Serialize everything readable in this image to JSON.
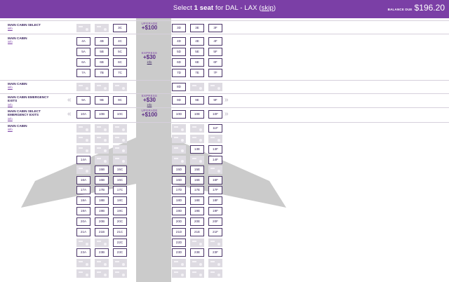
{
  "header": {
    "prefix": "Select",
    "count": "1 seat",
    "route_prefix": "for DAL - LAX",
    "skip": "skip",
    "balance_label": "BALANCE DUE",
    "balance_amount": "$196.20"
  },
  "colors": {
    "brand": "#7b3fa6",
    "seat_border": "#4a3468",
    "taken": "#dedbe2",
    "plane": "#c8c8c8"
  },
  "info_label": "info",
  "cabins": [
    {
      "name": "MAIN CABIN SELECT"
    },
    {
      "name": "MAIN CABIN"
    },
    {
      "name": "MAIN CABIN"
    },
    {
      "name": "MAIN CABIN EMERGENCY EXITS"
    },
    {
      "name": "MAIN CABIN SELECT EMERGENCY EXITS"
    },
    {
      "name": "MAIN CABIN"
    }
  ],
  "upsells": [
    {
      "kind": "UPGRADE",
      "price": "+$100",
      "info": ""
    },
    {
      "kind": "EXPRESS",
      "price": "+$30",
      "info": "info"
    },
    {
      "kind": "EXPRESS",
      "price": "+$30",
      "info": "info"
    },
    {
      "kind": "UPGRADE",
      "price": "+$100",
      "info": ""
    }
  ],
  "exit_markers": [
    "«",
    "»"
  ],
  "rows": [
    {
      "label": "3",
      "seats": [
        [
          "3A",
          "taken"
        ],
        [
          "3B",
          "taken"
        ],
        [
          "3C",
          "open"
        ],
        [
          "3D",
          "open"
        ],
        [
          "3E",
          "open"
        ],
        [
          "3F",
          "open"
        ]
      ]
    },
    {
      "label": "4",
      "seats": [
        [
          "4A",
          "open"
        ],
        [
          "4B",
          "open"
        ],
        [
          "4C",
          "open"
        ],
        [
          "4D",
          "open"
        ],
        [
          "4E",
          "open"
        ],
        [
          "4F",
          "open"
        ]
      ]
    },
    {
      "label": "5",
      "seats": [
        [
          "5A",
          "open"
        ],
        [
          "5B",
          "open"
        ],
        [
          "5C",
          "open"
        ],
        [
          "5D",
          "open"
        ],
        [
          "5E",
          "open"
        ],
        [
          "5F",
          "open"
        ]
      ]
    },
    {
      "label": "6",
      "seats": [
        [
          "6A",
          "open"
        ],
        [
          "6B",
          "open"
        ],
        [
          "6C",
          "open"
        ],
        [
          "6D",
          "open"
        ],
        [
          "6E",
          "open"
        ],
        [
          "6F",
          "open"
        ]
      ]
    },
    {
      "label": "7",
      "seats": [
        [
          "7A",
          "open"
        ],
        [
          "7B",
          "open"
        ],
        [
          "7C",
          "open"
        ],
        [
          "7D",
          "open"
        ],
        [
          "7E",
          "open"
        ],
        [
          "7F",
          "open"
        ]
      ]
    },
    {
      "label": "8",
      "seats": [
        [
          "8A",
          "taken"
        ],
        [
          "8B",
          "taken"
        ],
        [
          "8C",
          "taken"
        ],
        [
          "8D",
          "open"
        ],
        [
          "8E",
          "taken"
        ],
        [
          "8F",
          "taken"
        ]
      ]
    },
    {
      "label": "9",
      "seats": [
        [
          "9A",
          "open"
        ],
        [
          "9B",
          "open"
        ],
        [
          "9C",
          "open"
        ],
        [
          "9D",
          "open"
        ],
        [
          "9E",
          "open"
        ],
        [
          "9F",
          "open"
        ]
      ]
    },
    {
      "label": "10",
      "seats": [
        [
          "10A",
          "open"
        ],
        [
          "10B",
          "open"
        ],
        [
          "10C",
          "open"
        ],
        [
          "10D",
          "open"
        ],
        [
          "10E",
          "open"
        ],
        [
          "10F",
          "open"
        ]
      ]
    },
    {
      "label": "11",
      "seats": [
        [
          "11A",
          "taken"
        ],
        [
          "11B",
          "taken"
        ],
        [
          "11C",
          "taken"
        ],
        [
          "11D",
          "taken"
        ],
        [
          "11E",
          "taken"
        ],
        [
          "11F",
          "open"
        ]
      ]
    },
    {
      "label": "12",
      "seats": [
        [
          "12A",
          "taken"
        ],
        [
          "12B",
          "taken"
        ],
        [
          "12C",
          "taken"
        ],
        [
          "12D",
          "taken"
        ],
        [
          "12E",
          "taken"
        ],
        [
          "12F",
          "taken"
        ]
      ]
    },
    {
      "label": "13",
      "seats": [
        [
          "13A",
          "taken"
        ],
        [
          "13B",
          "taken"
        ],
        [
          "13C",
          "taken"
        ],
        [
          "13D",
          "taken"
        ],
        [
          "13E",
          "open"
        ],
        [
          "13F",
          "open"
        ]
      ]
    },
    {
      "label": "14",
      "seats": [
        [
          "14A",
          "open"
        ],
        [
          "14B",
          "taken"
        ],
        [
          "14C",
          "taken"
        ],
        [
          "14D",
          "taken"
        ],
        [
          "14E",
          "taken"
        ],
        [
          "14F",
          "open"
        ]
      ]
    },
    {
      "label": "15",
      "seats": [
        [
          "15A",
          "taken"
        ],
        [
          "15B",
          "open"
        ],
        [
          "15C",
          "open"
        ],
        [
          "15D",
          "open"
        ],
        [
          "15E",
          "open"
        ],
        [
          "15F",
          "taken"
        ]
      ]
    },
    {
      "label": "16",
      "seats": [
        [
          "16A",
          "open"
        ],
        [
          "16B",
          "open"
        ],
        [
          "16C",
          "open"
        ],
        [
          "16D",
          "open"
        ],
        [
          "16E",
          "open"
        ],
        [
          "16F",
          "open"
        ]
      ]
    },
    {
      "label": "17",
      "seats": [
        [
          "17A",
          "open"
        ],
        [
          "17B",
          "open"
        ],
        [
          "17C",
          "open"
        ],
        [
          "17D",
          "open"
        ],
        [
          "17E",
          "open"
        ],
        [
          "17F",
          "open"
        ]
      ]
    },
    {
      "label": "18",
      "seats": [
        [
          "18A",
          "open"
        ],
        [
          "18B",
          "open"
        ],
        [
          "18C",
          "open"
        ],
        [
          "18D",
          "open"
        ],
        [
          "18E",
          "open"
        ],
        [
          "18F",
          "open"
        ]
      ]
    },
    {
      "label": "19",
      "seats": [
        [
          "19A",
          "open"
        ],
        [
          "19B",
          "open"
        ],
        [
          "19C",
          "open"
        ],
        [
          "19D",
          "open"
        ],
        [
          "19E",
          "open"
        ],
        [
          "19F",
          "open"
        ]
      ]
    },
    {
      "label": "20",
      "seats": [
        [
          "20A",
          "open"
        ],
        [
          "20B",
          "open"
        ],
        [
          "20C",
          "open"
        ],
        [
          "20D",
          "open"
        ],
        [
          "20E",
          "open"
        ],
        [
          "20F",
          "open"
        ]
      ]
    },
    {
      "label": "21",
      "seats": [
        [
          "21A",
          "open"
        ],
        [
          "21B",
          "open"
        ],
        [
          "21C",
          "open"
        ],
        [
          "21D",
          "open"
        ],
        [
          "21E",
          "open"
        ],
        [
          "21F",
          "open"
        ]
      ]
    },
    {
      "label": "22",
      "seats": [
        [
          "22A",
          "taken"
        ],
        [
          "22B",
          "taken"
        ],
        [
          "22C",
          "open"
        ],
        [
          "22D",
          "open"
        ],
        [
          "22E",
          "taken"
        ],
        [
          "22F",
          "taken"
        ]
      ]
    },
    {
      "label": "23",
      "seats": [
        [
          "23A",
          "open"
        ],
        [
          "23B",
          "open"
        ],
        [
          "23C",
          "open"
        ],
        [
          "23D",
          "open"
        ],
        [
          "23E",
          "open"
        ],
        [
          "23F",
          "open"
        ]
      ]
    },
    {
      "label": "24",
      "seats": [
        [
          "24A",
          "taken"
        ],
        [
          "24B",
          "taken"
        ],
        [
          "24C",
          "taken"
        ],
        [
          "24D",
          "taken"
        ],
        [
          "24E",
          "taken"
        ],
        [
          "24F",
          "taken"
        ]
      ]
    },
    {
      "label": "25",
      "seats": [
        [
          "25A",
          "taken"
        ],
        [
          "25B",
          "taken"
        ],
        [
          "25C",
          "taken"
        ],
        [
          "25D",
          "taken"
        ],
        [
          "25E",
          "taken"
        ],
        [
          "25F",
          "taken"
        ]
      ]
    }
  ]
}
